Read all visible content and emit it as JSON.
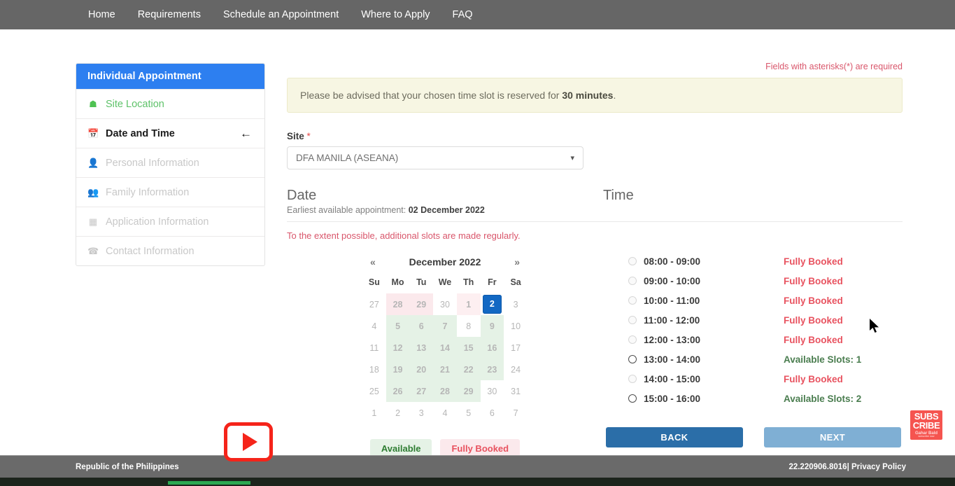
{
  "nav": {
    "items": [
      {
        "label": "Home"
      },
      {
        "label": "Requirements"
      },
      {
        "label": "Schedule an Appointment"
      },
      {
        "label": "Where to Apply"
      },
      {
        "label": "FAQ"
      }
    ]
  },
  "sidebar": {
    "title": "Individual Appointment",
    "items": [
      {
        "label": "Site Location",
        "icon": "home-icon",
        "glyph": "⌂",
        "state": "done"
      },
      {
        "label": "Date and Time",
        "icon": "calendar-icon",
        "glyph": "▦",
        "state": "active",
        "arrow": "←"
      },
      {
        "label": "Personal Information",
        "icon": "user-icon",
        "glyph": "●",
        "state": "disabled"
      },
      {
        "label": "Family Information",
        "icon": "users-icon",
        "glyph": "●●",
        "state": "disabled"
      },
      {
        "label": "Application Information",
        "icon": "form-icon",
        "glyph": "▤",
        "state": "disabled"
      },
      {
        "label": "Contact Information",
        "icon": "phone-icon",
        "glyph": "☎",
        "state": "disabled"
      }
    ]
  },
  "main": {
    "required_note": "Fields with asterisks(*) are required",
    "alert_prefix": "Please be advised that your chosen time slot is reserved for ",
    "alert_bold": "30 minutes",
    "alert_suffix": ".",
    "site_label": "Site",
    "site_required_mark": "*",
    "site_value": "DFA MANILA (ASEANA)",
    "site_caret": "⌄"
  },
  "date_section": {
    "title": "Date",
    "earliest_prefix": "Earliest available appointment: ",
    "earliest_date": "02 December 2022",
    "notice": "To the extent possible, additional slots are made regularly."
  },
  "calendar": {
    "prev": "«",
    "next": "»",
    "month_label": "December 2022",
    "weekdays": [
      "Su",
      "Mo",
      "Tu",
      "We",
      "Th",
      "Fr",
      "Sa"
    ],
    "weeks": [
      [
        {
          "d": "27",
          "t": "other"
        },
        {
          "d": "28",
          "t": "booked"
        },
        {
          "d": "29",
          "t": "booked"
        },
        {
          "d": "30",
          "t": "other"
        },
        {
          "d": "1",
          "t": "bookedr"
        },
        {
          "d": "2",
          "t": "sel"
        },
        {
          "d": "3",
          "t": "other"
        }
      ],
      [
        {
          "d": "4",
          "t": "other"
        },
        {
          "d": "5",
          "t": "avail"
        },
        {
          "d": "6",
          "t": "avail"
        },
        {
          "d": "7",
          "t": "avail"
        },
        {
          "d": "8",
          "t": "other"
        },
        {
          "d": "9",
          "t": "avail"
        },
        {
          "d": "10",
          "t": "other"
        }
      ],
      [
        {
          "d": "11",
          "t": "other"
        },
        {
          "d": "12",
          "t": "avail"
        },
        {
          "d": "13",
          "t": "avail"
        },
        {
          "d": "14",
          "t": "avail"
        },
        {
          "d": "15",
          "t": "avail"
        },
        {
          "d": "16",
          "t": "avail"
        },
        {
          "d": "17",
          "t": "other"
        }
      ],
      [
        {
          "d": "18",
          "t": "other"
        },
        {
          "d": "19",
          "t": "avail"
        },
        {
          "d": "20",
          "t": "avail"
        },
        {
          "d": "21",
          "t": "avail"
        },
        {
          "d": "22",
          "t": "avail"
        },
        {
          "d": "23",
          "t": "avail"
        },
        {
          "d": "24",
          "t": "other"
        }
      ],
      [
        {
          "d": "25",
          "t": "other"
        },
        {
          "d": "26",
          "t": "avail"
        },
        {
          "d": "27",
          "t": "avail"
        },
        {
          "d": "28",
          "t": "avail"
        },
        {
          "d": "29",
          "t": "avail"
        },
        {
          "d": "30",
          "t": "other"
        },
        {
          "d": "31",
          "t": "other"
        }
      ],
      [
        {
          "d": "1",
          "t": "other"
        },
        {
          "d": "2",
          "t": "other"
        },
        {
          "d": "3",
          "t": "other"
        },
        {
          "d": "4",
          "t": "other"
        },
        {
          "d": "5",
          "t": "other"
        },
        {
          "d": "6",
          "t": "other"
        },
        {
          "d": "7",
          "t": "other"
        }
      ]
    ],
    "legend": [
      {
        "label": "Available",
        "kind": "ok"
      },
      {
        "label": "Fully Booked",
        "kind": "no"
      }
    ]
  },
  "time_section": {
    "title": "Time",
    "slots": [
      {
        "time": "08:00 - 09:00",
        "status": "Fully Booked",
        "available": false
      },
      {
        "time": "09:00 - 10:00",
        "status": "Fully Booked",
        "available": false
      },
      {
        "time": "10:00 - 11:00",
        "status": "Fully Booked",
        "available": false
      },
      {
        "time": "11:00 - 12:00",
        "status": "Fully Booked",
        "available": false
      },
      {
        "time": "12:00 - 13:00",
        "status": "Fully Booked",
        "available": false
      },
      {
        "time": "13:00 - 14:00",
        "status": "Available Slots: 1",
        "available": true
      },
      {
        "time": "14:00 - 15:00",
        "status": "Fully Booked",
        "available": false
      },
      {
        "time": "15:00 - 16:00",
        "status": "Available Slots: 2",
        "available": true
      }
    ]
  },
  "buttons": {
    "back": "BACK",
    "next": "NEXT"
  },
  "footer": {
    "left": "Republic of the Philippines",
    "version": "22.220906.8016",
    "separator": "| ",
    "privacy": "Privacy Policy"
  },
  "overlay": {
    "subscribe_line1": "SUBS",
    "subscribe_line2": "CRIBE",
    "subscribe_line3": "Gahar Bald",
    "subscribe_line4": "subscribe now"
  },
  "colors": {
    "nav_bg": "#666666",
    "accent_blue": "#2d7ff0",
    "selected_day": "#1268c3",
    "available_green": "#2e7d32",
    "booked_red": "#e8525f",
    "back_button": "#2b6ea8",
    "next_button": "#7fafd4",
    "alert_bg": "#f7f6e3"
  }
}
